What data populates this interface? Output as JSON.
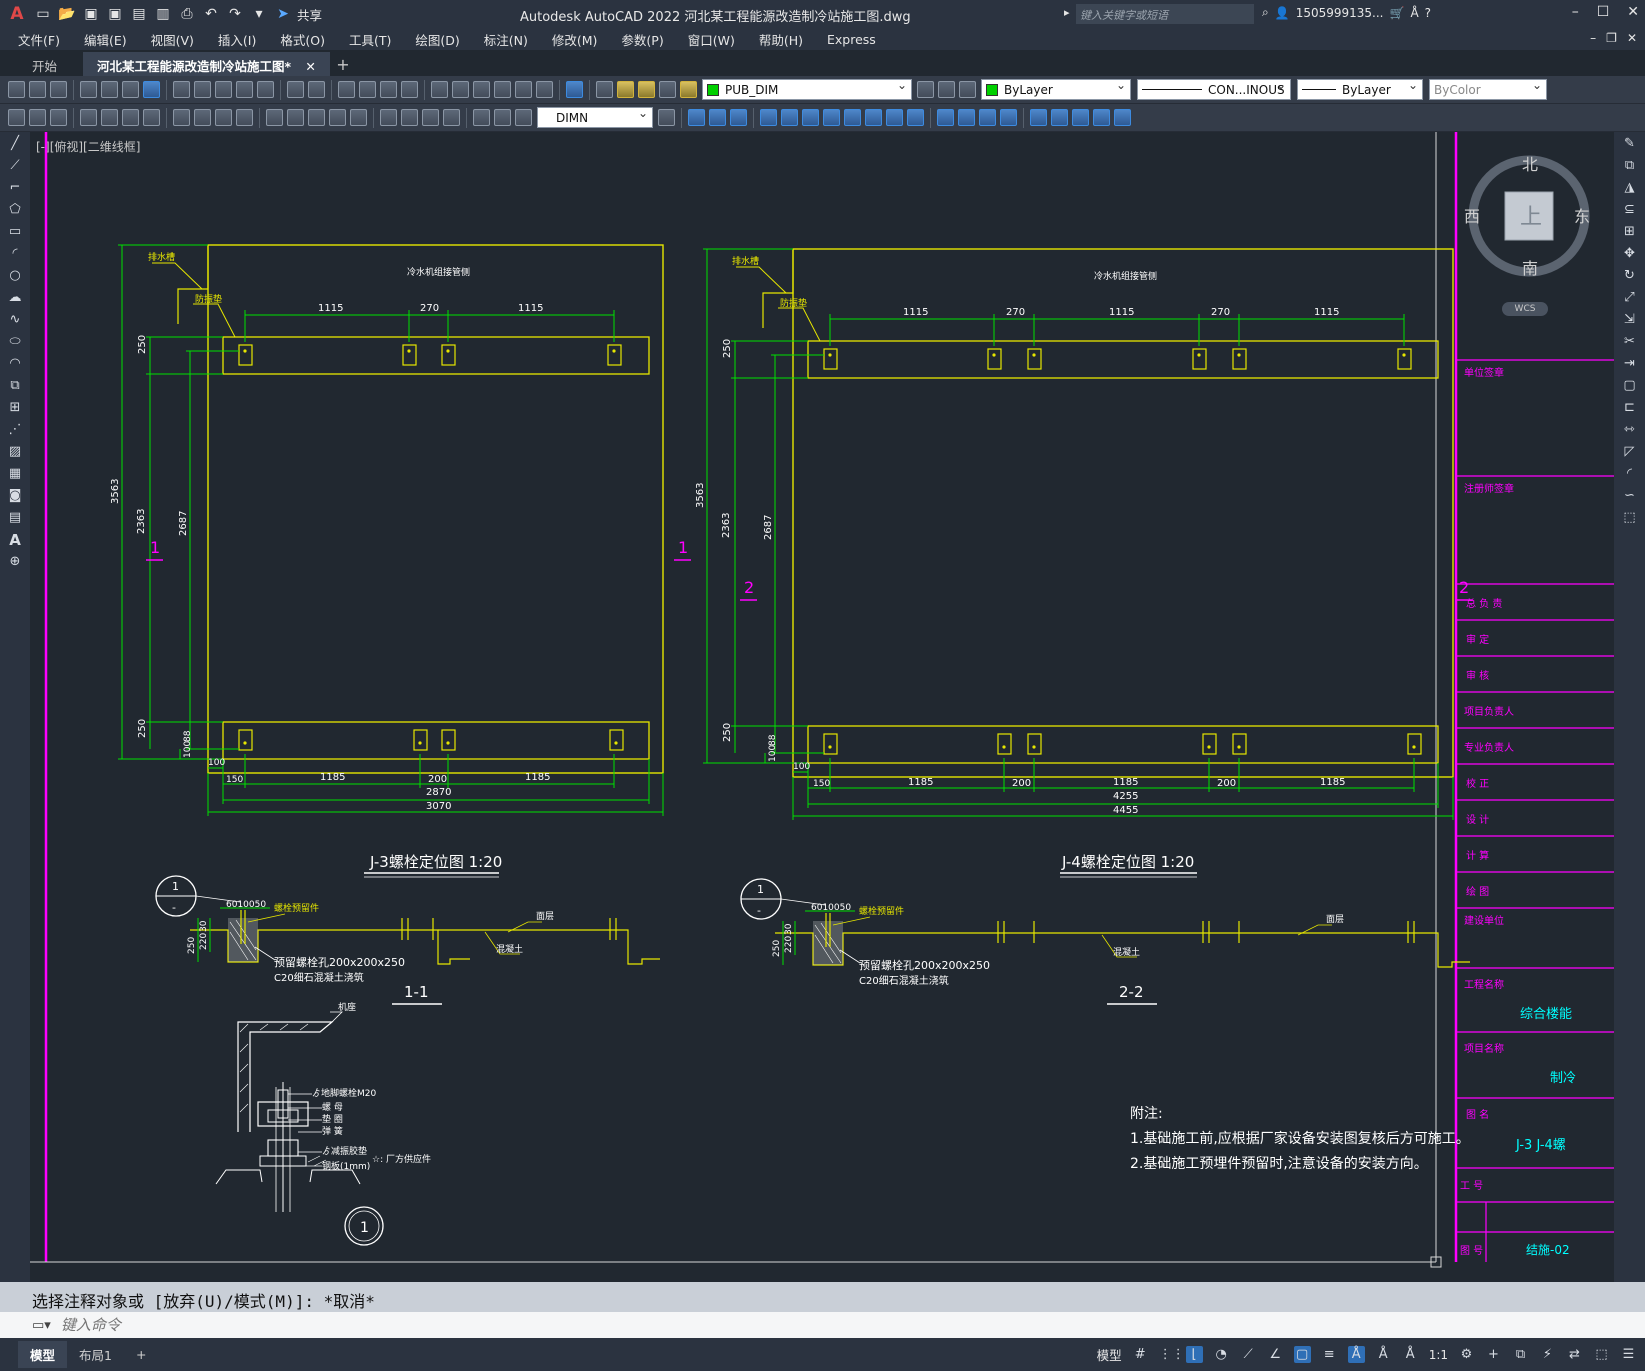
{
  "app": {
    "logo": "A",
    "share_label": "共享",
    "title": "Autodesk AutoCAD 2022    河北某工程能源改造制冷站施工图.dwg",
    "search_placeholder": "键入关键字或短语",
    "user": "1505999135...",
    "window_controls": [
      "–",
      "☐",
      "✕"
    ]
  },
  "menu": [
    "文件(F)",
    "编辑(E)",
    "视图(V)",
    "插入(I)",
    "格式(O)",
    "工具(T)",
    "绘图(D)",
    "标注(N)",
    "修改(M)",
    "参数(P)",
    "窗口(W)",
    "帮助(H)",
    "Express"
  ],
  "tabs": {
    "start": "开始",
    "active": "河北某工程能源改造制冷站施工图*",
    "close": "✕",
    "add": "+"
  },
  "toolbar": {
    "layer": "PUB_DIM",
    "color": "ByLayer",
    "linetype": "CON...INOUS",
    "lineweight": "ByLayer",
    "plotstyle": "ByColor",
    "dimstyle": "DIMN"
  },
  "viewport_label": "[-][俯视][二维线框]",
  "viewcube": {
    "north": "北",
    "south": "南",
    "east": "东",
    "west": "西",
    "face": "上",
    "wcs": "WCS"
  },
  "drawing": {
    "j3": {
      "drain": "排水槽",
      "rubber": "防振垫",
      "side": "冷水机组接管侧",
      "top_dims": [
        "1115",
        "270",
        "1115"
      ],
      "left_dims": [
        "250",
        "3563",
        "2363",
        "2687",
        "250",
        "100",
        "88"
      ],
      "bottom_dims": [
        "100",
        "150",
        "1185",
        "200",
        "1185",
        "2870",
        "3070"
      ],
      "mark": "1",
      "title": "J-3螺栓定位图 1:20"
    },
    "j4": {
      "drain": "排水槽",
      "rubber": "防振垫",
      "side": "冷水机组接管侧",
      "top_dims": [
        "1115",
        "270",
        "1115",
        "270",
        "1115"
      ],
      "left_dims": [
        "250",
        "3563",
        "2363",
        "2687",
        "250",
        "100",
        "88"
      ],
      "bottom_dims": [
        "100",
        "150",
        "1185",
        "200",
        "1185",
        "200",
        "1185",
        "4255",
        "4455"
      ],
      "mark_left": "1",
      "mark_2a": "2",
      "mark_2b": "2",
      "title": "J-4螺栓定位图 1:20"
    },
    "s11": {
      "circle_top": "1",
      "circle_bot": "-",
      "dims_top": "6010050",
      "dims_v": [
        "250",
        "220",
        "30"
      ],
      "bolt_label": "螺栓预留件",
      "hole_label": "预留螺栓孔200x200x250",
      "fill_label": "C20细石混凝土浇筑",
      "plaster": "面层",
      "concrete": "混凝土",
      "title": "1-1"
    },
    "s22": {
      "circle_top": "1",
      "circle_bot": "-",
      "dims_top": "6010050",
      "dims_v": [
        "250",
        "220",
        "30"
      ],
      "bolt_label": "螺栓预留件",
      "hole_label": "预留螺栓孔200x200x250",
      "fill_label": "C20细石混凝土浇筑",
      "plaster": "面层",
      "concrete": "混凝土",
      "title": "2-2"
    },
    "detail": {
      "base": "机座",
      "bolt": "ゟ地脚螺栓M20",
      "nut": "螺  母",
      "washer": "垫  圈",
      "spring": "弹  簧",
      "pad": "ゟ减振胶垫",
      "plate": "钢板(1mm)",
      "note": "☆: 厂方供应件",
      "mark": "1"
    },
    "notes": {
      "heading": "附注:",
      "line1": "1.基础施工前,应根据厂家设备安装图复核后方可施工。",
      "line2": "2.基础施工预埋件预留时,注意设备的安装方向。"
    },
    "titleblock": {
      "unit_sign": "单位签章",
      "engineer_sign": "注册师签章",
      "rows": [
        "总  负  责",
        "审    定",
        "审    核",
        "项目负责人",
        "专业负责人",
        "校    正",
        "设    计",
        "计    算",
        "绘    图"
      ],
      "build_unit": "建设单位",
      "project_name_label": "工程名称",
      "project_name": "综合楼能",
      "item_name_label": "项目名称",
      "item_name": "制冷",
      "drawing_name_label": "图  名",
      "drawing_name": "J-3 J-4螺",
      "job_no": "工  号",
      "drawing_no_label": "图  号",
      "drawing_no": "结施-02"
    }
  },
  "command": {
    "history": "选择注释对象或 [放弃(U)/模式(M)]: *取消*",
    "placeholder": "键入命令"
  },
  "status": {
    "tabs": [
      "模型",
      "布局1",
      "+"
    ],
    "model_label": "模型",
    "scale": "1:1"
  }
}
